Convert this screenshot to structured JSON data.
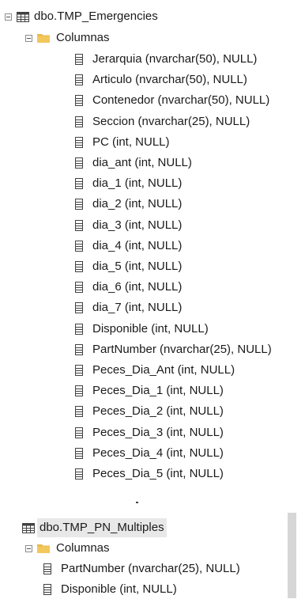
{
  "tree": {
    "tables": [
      {
        "name": "dbo.TMP_Emergencies",
        "folder_label": "Columnas",
        "columns": [
          "Jerarquia (nvarchar(50), NULL)",
          "Articulo (nvarchar(50), NULL)",
          "Contenedor (nvarchar(50), NULL)",
          "Seccion (nvarchar(25), NULL)",
          "PC (int, NULL)",
          "dia_ant (int, NULL)",
          "dia_1 (int, NULL)",
          "dia_2 (int, NULL)",
          "dia_3 (int, NULL)",
          "dia_4 (int, NULL)",
          "dia_5 (int, NULL)",
          "dia_6 (int, NULL)",
          "dia_7 (int, NULL)",
          "Disponible (int, NULL)",
          "PartNumber (nvarchar(25), NULL)",
          "Peces_Dia_Ant (int, NULL)",
          "Peces_Dia_1 (int, NULL)",
          "Peces_Dia_2 (int, NULL)",
          "Peces_Dia_3 (int, NULL)",
          "Peces_Dia_4 (int, NULL)",
          "Peces_Dia_5 (int, NULL)"
        ]
      },
      {
        "name": "dbo.TMP_PN_Multiples",
        "folder_label": "Columnas",
        "columns": [
          "PartNumber (nvarchar(25), NULL)",
          "Disponible (int, NULL)"
        ]
      }
    ]
  },
  "icons": {
    "expander": "collapse-minus-icon",
    "table": "table-icon",
    "folder": "folder-icon",
    "column": "column-icon"
  },
  "colors": {
    "folder": "#e8b84a",
    "icon_stroke": "#424242",
    "selection_bg": "#e8e8e8"
  }
}
